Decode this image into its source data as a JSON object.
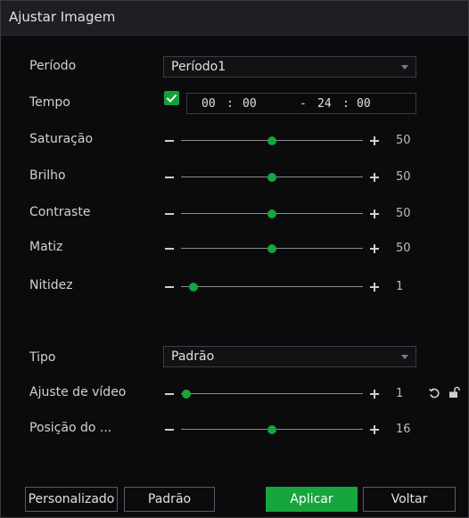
{
  "dialog": {
    "title": "Ajustar Imagem"
  },
  "periodo": {
    "label": "Período",
    "value": "Período1"
  },
  "tempo": {
    "label": "Tempo",
    "enabled": true,
    "start_h": "00",
    "start_m": "00",
    "end_h": "24",
    "end_m": "00",
    "sep": ":",
    "dash": "-"
  },
  "sliders": [
    {
      "label": "Saturação",
      "value": "50",
      "level": 0.5
    },
    {
      "label": "Brilho",
      "value": "50",
      "level": 0.5
    },
    {
      "label": "Contraste",
      "value": "50",
      "level": 0.5
    },
    {
      "label": "Matiz",
      "value": "50",
      "level": 0.5
    },
    {
      "label": "Nitidez",
      "value": "1",
      "level": 0.07
    }
  ],
  "tipo": {
    "label": "Tipo",
    "value": "Padrão"
  },
  "ajuste": {
    "label": "Ajuste de vídeo",
    "value": "1",
    "level": 0.03
  },
  "posicao": {
    "label": "Posição do ...",
    "value": "16",
    "level": 0.5
  },
  "buttons": {
    "personalizado": "Personalizado",
    "padrao": "Padrão",
    "aplicar": "Aplicar",
    "voltar": "Voltar"
  },
  "colors": {
    "accent": "#17a53d",
    "background": "#0b0b0d",
    "titlebar": "#1f1f23"
  },
  "icons": {
    "reset": "reset-icon",
    "lock": "unlock-icon"
  }
}
